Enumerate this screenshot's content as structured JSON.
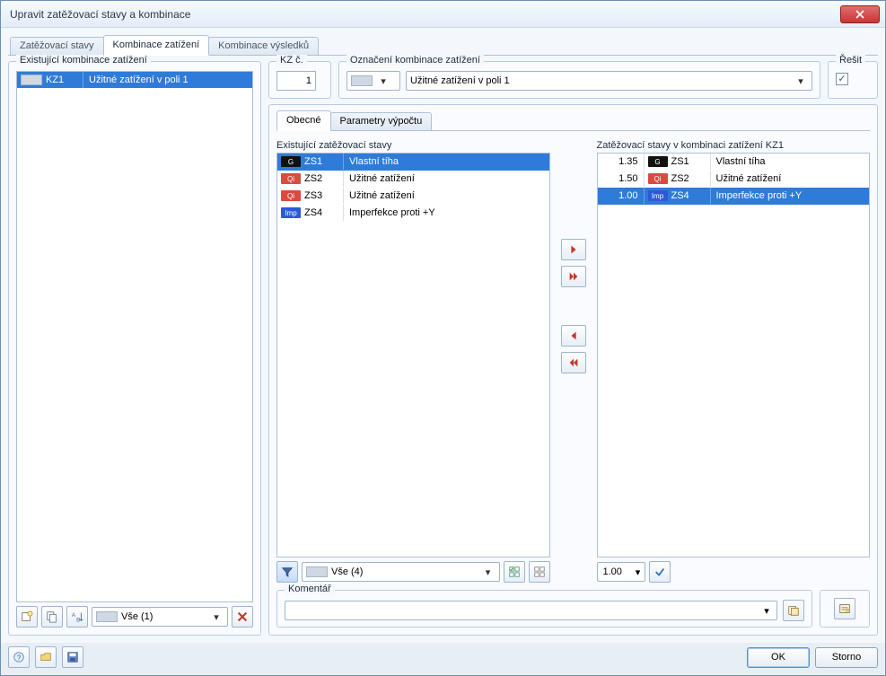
{
  "window": {
    "title": "Upravit zatěžovací stavy a kombinace"
  },
  "tabs": {
    "load_cases": "Zatěžovací stavy",
    "load_combinations": "Kombinace zatížení",
    "result_combinations": "Kombinace výsledků"
  },
  "left": {
    "legend": "Existující kombinace zatížení",
    "rows": [
      {
        "code": "KZ1",
        "name": "Užitné zatížení v poli 1"
      }
    ],
    "filter": "Vše (1)"
  },
  "header": {
    "kz_label": "KZ č.",
    "kz_value": "1",
    "designation_label": "Označení kombinace zatížení",
    "designation_value": "Užitné zatížení v poli 1",
    "solve_label": "Řešit",
    "solve_checked": true
  },
  "inner_tabs": {
    "general": "Obecné",
    "calc_params": "Parametry výpočtu"
  },
  "left_list": {
    "title": "Existující zatěžovací stavy",
    "rows": [
      {
        "tag": "G",
        "tag_class": "tag-g",
        "code": "ZS1",
        "name": "Vlastní tíha",
        "selected": true
      },
      {
        "tag": "Qi",
        "tag_class": "tag-qi",
        "code": "ZS2",
        "name": "Užitné zatížení",
        "selected": false
      },
      {
        "tag": "Qi",
        "tag_class": "tag-qi",
        "code": "ZS3",
        "name": "Užitné zatížení",
        "selected": false
      },
      {
        "tag": "Imp",
        "tag_class": "tag-imp",
        "code": "ZS4",
        "name": "Imperfekce proti +Y",
        "selected": false
      }
    ],
    "filter": "Vše (4)"
  },
  "right_list": {
    "title": "Zatěžovací stavy v kombinaci zatížení KZ1",
    "rows": [
      {
        "factor": "1.35",
        "tag": "G",
        "tag_class": "tag-g",
        "code": "ZS1",
        "name": "Vlastní tíha",
        "selected": false
      },
      {
        "factor": "1.50",
        "tag": "Qi",
        "tag_class": "tag-qi",
        "code": "ZS2",
        "name": "Užitné zatížení",
        "selected": false
      },
      {
        "factor": "1.00",
        "tag": "Imp",
        "tag_class": "tag-imp",
        "code": "ZS4",
        "name": "Imperfekce proti +Y",
        "selected": true
      }
    ],
    "factor_value": "1.00"
  },
  "comment": {
    "label": "Komentář"
  },
  "buttons": {
    "ok": "OK",
    "cancel": "Storno"
  }
}
